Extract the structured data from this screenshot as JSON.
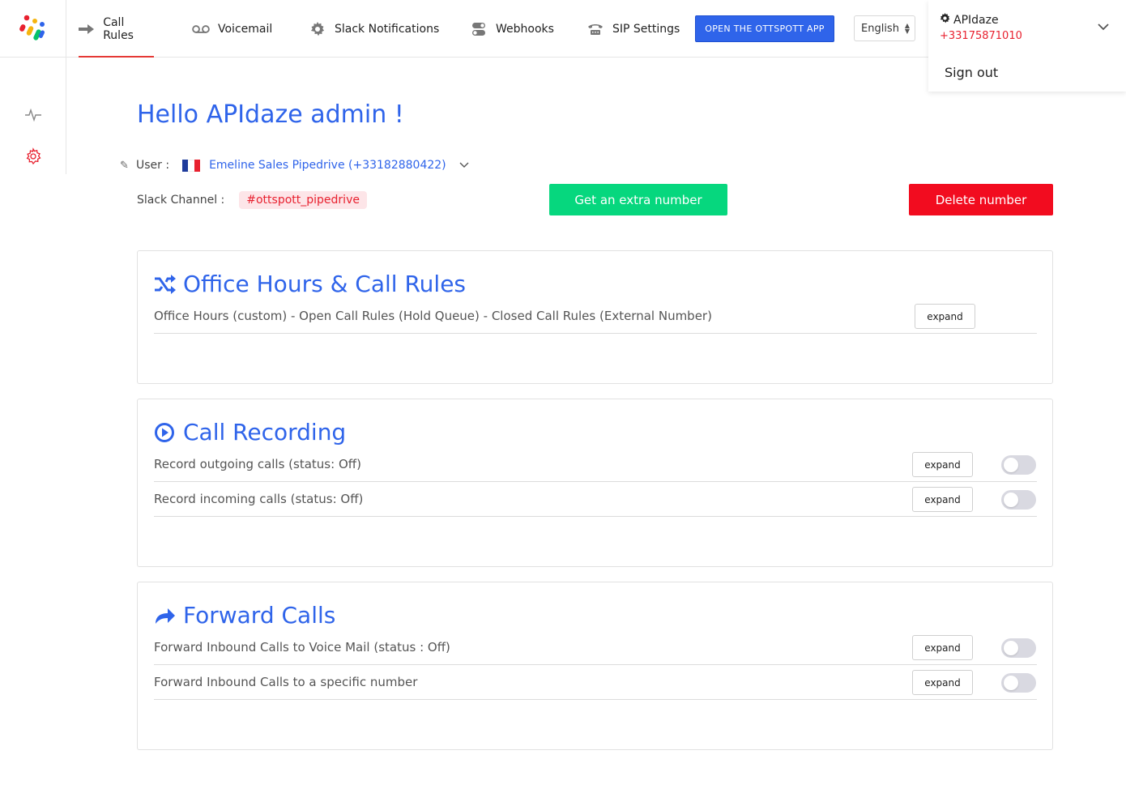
{
  "nav": {
    "items": [
      {
        "label": "Call Rules",
        "icon": "arrow-right-icon",
        "active": true
      },
      {
        "label": "Voicemail",
        "icon": "voicemail-icon",
        "active": false
      },
      {
        "label": "Slack Notifications",
        "icon": "gear-icon",
        "active": false
      },
      {
        "label": "Webhooks",
        "icon": "toggle-switch-icon",
        "active": false
      },
      {
        "label": "SIP Settings",
        "icon": "phone-icon",
        "active": false
      }
    ],
    "open_app_label": "OPEN THE OTTSPOTT APP",
    "language": "English"
  },
  "account": {
    "name": "APIdaze",
    "phone": "+33175871010",
    "signout_label": "Sign out"
  },
  "main": {
    "greeting": "Hello APIdaze admin !",
    "user_label": "User :",
    "user_value": "Emeline Sales Pipedrive (+33182880422)",
    "slack_label": "Slack Channel :",
    "slack_channel": "#ottspott_pipedrive",
    "extra_number_label": "Get an extra number",
    "delete_number_label": "Delete number"
  },
  "sections": {
    "office": {
      "title": "Office Hours & Call Rules",
      "row": "Office Hours (custom) - Open Call Rules (Hold Queue) - Closed Call Rules (External Number)",
      "expand": "expand"
    },
    "recording": {
      "title": "Call Recording",
      "rows": [
        {
          "label": "Record outgoing calls (status: Off)",
          "expand": "expand",
          "enabled": false
        },
        {
          "label": "Record incoming calls (status: Off)",
          "expand": "expand",
          "enabled": false
        }
      ]
    },
    "forward": {
      "title": "Forward Calls",
      "rows": [
        {
          "label": "Forward Inbound Calls to Voice Mail (status : Off)",
          "expand": "expand",
          "enabled": false
        },
        {
          "label": "Forward Inbound Calls to a specific number",
          "expand": "expand",
          "enabled": false
        }
      ]
    }
  },
  "colors": {
    "accent": "#2f64ea",
    "danger": "#f20c1f",
    "success": "#06d77e",
    "brand_red": "#e8212f"
  }
}
